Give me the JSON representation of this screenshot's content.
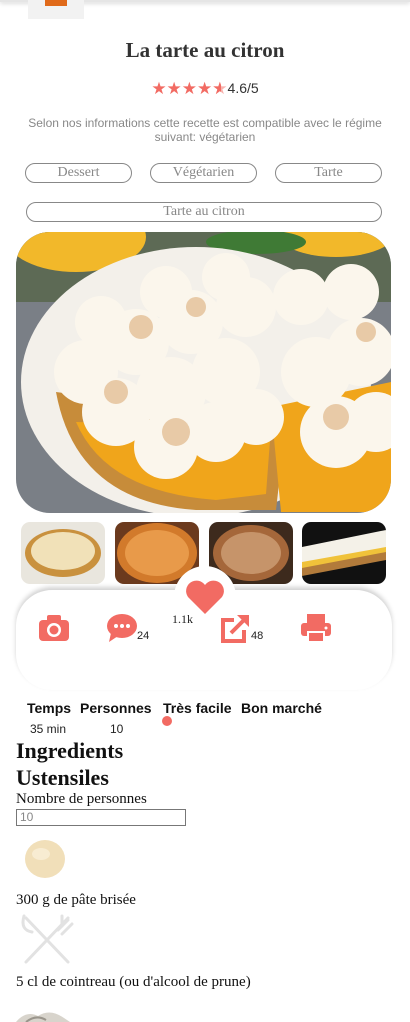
{
  "recipe": {
    "title": "La tarte au citron",
    "rating_text": "4.6/5",
    "rating_value": 4.6,
    "compat_text": "Selon nos informations cette recette est compatible avec le régime suivant: végétarien",
    "tags": [
      "Dessert",
      "Végétarien",
      "Tarte"
    ],
    "search_tag": "Tarte au citron"
  },
  "actions": {
    "comments_count": "24",
    "share_count": "48",
    "likes_count": "1.1k"
  },
  "info": {
    "headers": [
      "Temps",
      "Personnes",
      "Très facile",
      "Bon marché"
    ],
    "time": "35 min",
    "persons": "10"
  },
  "sections": {
    "ingredients": "Ingredients",
    "ustensiles": "Ustensiles",
    "persons_label": "Nombre de personnes",
    "persons_value": "10"
  },
  "ingredients": [
    {
      "text": "300 g de pâte brisée",
      "icon": "dough-ball-icon"
    },
    {
      "text": "5 cl de cointreau (ou d'alcool de prune)",
      "icon": "fork-knife-icon"
    }
  ],
  "colors": {
    "accent": "#f26b63",
    "tag_border": "#888888"
  }
}
